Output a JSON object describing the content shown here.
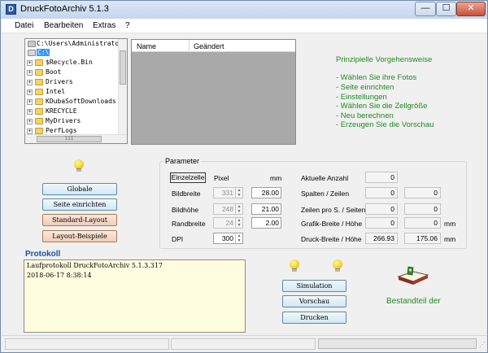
{
  "window": {
    "title": "DruckFotoArchiv  5.1.3",
    "app_icon_letter": "D",
    "min_glyph": "—",
    "max_glyph": "☐",
    "close_glyph": "✕"
  },
  "menu": [
    "Datei",
    "Bearbeiten",
    "Extras",
    "?"
  ],
  "tree": {
    "root": "C:\\Users\\Administrator\\",
    "drive": "C:\\",
    "items": [
      "$Recycle.Bin",
      "Boot",
      "Drivers",
      "Intel",
      "KDubaSoftDownloads",
      "KRECYCLE",
      "MyDrivers",
      "PerfLogs"
    ],
    "hscroll_glyph": "III"
  },
  "file_list": {
    "columns": [
      "Name",
      "Geändert"
    ],
    "rows": []
  },
  "instructions": {
    "heading": "Prinzipielle Vorgehensweise",
    "steps": [
      "- Wählen Sie ihre Fotos",
      "- Seite einrichten",
      "- Einstellungen",
      "- Wählen Sie die Zellgröße",
      "- Neu berechnen",
      "- Erzeugen Sie die Vorschau"
    ]
  },
  "left_buttons": {
    "globale": "Globale",
    "seite": "Seite einrichten",
    "standard": "Standard-Layout",
    "beispiele": "Layout-Beispiele"
  },
  "parameter": {
    "title": "Parameter",
    "einzelzelle": "Einzelzelle",
    "pixel_header": "Pixel",
    "mm_header": "mm",
    "rows": [
      {
        "label": "Bildbreite",
        "pixel": "331",
        "mm": "28.00"
      },
      {
        "label": "Bildhöhe",
        "pixel": "248",
        "mm": "21.00"
      },
      {
        "label": "Randbreite",
        "pixel": "24",
        "mm": "2.00"
      },
      {
        "label": "DPI",
        "pixel": "300",
        "mm": ""
      }
    ],
    "right_rows": [
      {
        "label": "Aktuelle Anzahl",
        "v1": "0",
        "v2": "",
        "unit": ""
      },
      {
        "label": "Spalten / Zeilen",
        "v1": "0",
        "v2": "0",
        "unit": ""
      },
      {
        "label": "Zeilen pro S. / Seiten",
        "v1": "0",
        "v2": "0",
        "unit": ""
      },
      {
        "label": "Grafik-Breite / Höhe",
        "v1": "0",
        "v2": "0",
        "unit": "mm"
      },
      {
        "label": "Druck-Breite / Höhe",
        "v1": "266.93",
        "v2": "175.06",
        "unit": "mm"
      }
    ]
  },
  "protokoll": {
    "title": "Protokoll",
    "lines": [
      "Laufprotokoll DruckFotoArchiv 5.1.3.317",
      "2018-06-17 8:38:14"
    ]
  },
  "action_buttons": {
    "simulation": "Simulation",
    "vorschau": "Vorschau",
    "drucken": "Drucken"
  },
  "bestandteil": "Bestandteil der",
  "statusbar": {
    "progress_fraction": 0.0,
    "grip": "⋰"
  },
  "colors": {
    "accent_green": "#1f8a1f",
    "protokoll_blue": "#1a4fa8",
    "list_background": "#a9a9a9"
  }
}
